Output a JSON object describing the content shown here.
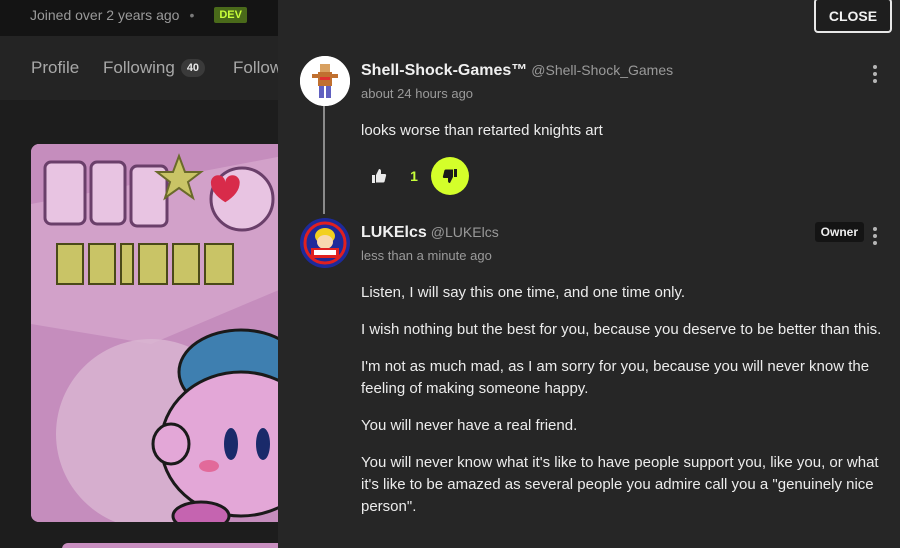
{
  "profile": {
    "joined": "Joined over 2 years ago",
    "badge": "DEV",
    "nav": [
      {
        "label": "Profile"
      },
      {
        "label": "Following",
        "count": "40"
      },
      {
        "label": "Follow"
      }
    ]
  },
  "panel": {
    "close_label": "CLOSE",
    "comments": [
      {
        "name": "Shell-Shock-Games™",
        "handle": "@Shell-Shock_Games",
        "time": "about 24 hours ago",
        "body": [
          "looks worse than retarted knights art"
        ],
        "votes": "1"
      },
      {
        "name": "LUKElcs",
        "handle": "@LUKElcs",
        "time": "less than a minute ago",
        "badge": "Owner",
        "body": [
          "Listen, I will say this one time, and one time only.",
          "I wish nothing but the best for you, because you deserve to be better than this.",
          "I'm not as much mad, as I am sorry for you, because you will never know the feeling of making someone happy.",
          "You will never have a real friend.",
          "You will never know what it's like to have people support you, like you, or what it's like to be amazed as several people you admire call you a \"genuinely nice person\"."
        ]
      }
    ]
  },
  "colors": {
    "accent": "#d4ff2a",
    "panel_bg": "#262626",
    "card_pink": "#c98fc0"
  }
}
